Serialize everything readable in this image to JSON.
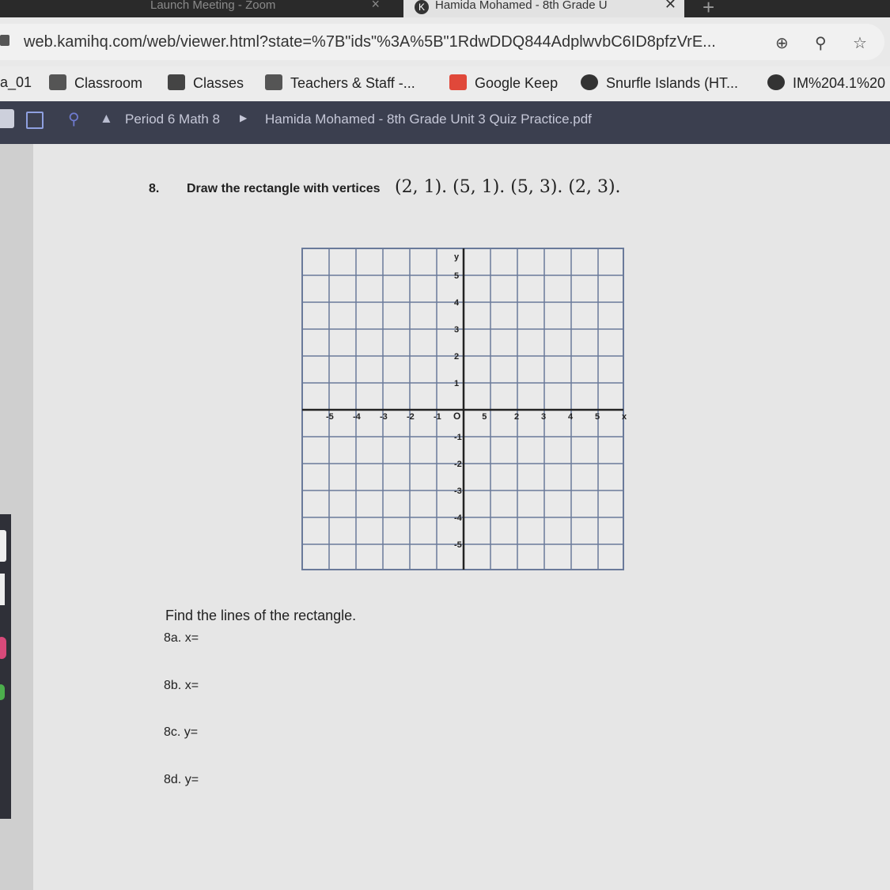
{
  "browser": {
    "tabs": [
      {
        "label": "Launch Meeting - Zoom",
        "active": false
      },
      {
        "label": "Hamida Mohamed - 8th Grade U",
        "active": true
      }
    ],
    "url": "web.kamihq.com/web/viewer.html?state=%7B\"ids\"%3A%5B\"1RdwDDQ844AdplwvbC6ID8pfzVrE...",
    "bookmarks": [
      {
        "label": "a_01",
        "icon": "none"
      },
      {
        "label": "Classroom",
        "icon": "classroom-icon"
      },
      {
        "label": "Classes",
        "icon": "classes-icon"
      },
      {
        "label": "Teachers & Staff -...",
        "icon": "classroom-icon"
      },
      {
        "label": "Google Keep",
        "icon": "keep-icon"
      },
      {
        "label": "Snurfle Islands (HT...",
        "icon": "snurfle-icon"
      },
      {
        "label": "IM%204.1%20",
        "icon": "kami-icon"
      }
    ]
  },
  "viewer": {
    "breadcrumb_folder": "Period 6 Math 8",
    "document_title": "Hamida Mohamed - 8th Grade Unit 3 Quiz Practice.pdf"
  },
  "question": {
    "number": "8.",
    "prompt": "Draw the rectangle with vertices",
    "vertices_text": "(2, 1). (5, 1). (5, 3). (2, 3)."
  },
  "graph": {
    "x_ticks": [
      "-5",
      "-4",
      "-3",
      "-2",
      "-1",
      "5",
      "2",
      "3",
      "4",
      "5",
      "x"
    ],
    "y_ticks": [
      "y",
      "5",
      "4",
      "3",
      "2",
      "1",
      "-1",
      "-2",
      "-3",
      "-4",
      "-5"
    ],
    "origin_label": "O"
  },
  "find": {
    "instruction": "Find the lines of the rectangle.",
    "parts": [
      "8a. x=",
      "8b. x=",
      "8c. y=",
      "8d. y="
    ]
  }
}
